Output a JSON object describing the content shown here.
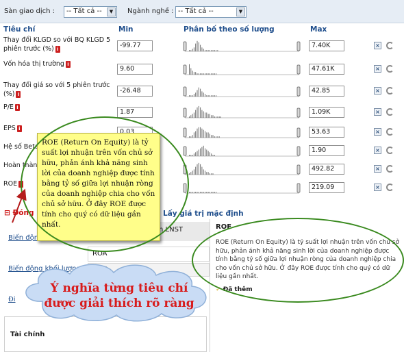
{
  "filters": {
    "exchange_label": "Sàn giao dịch :",
    "exchange_value": "-- Tất cả --",
    "industry_label": "Ngành nghề :",
    "industry_value": "-- Tất cả --"
  },
  "columns": {
    "criteria": "Tiêu chí",
    "min": "Min",
    "distribution": "Phân bố theo số lượng",
    "max": "Max"
  },
  "rows": [
    {
      "label": "Thay đổi KLGD so với BQ KLGD 5 phiên trước (%)",
      "min": "-99.77",
      "max": "7.40K"
    },
    {
      "label": "Vốn hóa thị trường",
      "min": "9.60",
      "max": "47.61K"
    },
    {
      "label": "Thay đổi giá so với 5 phiên trước (%)",
      "min": "-26.48",
      "max": "42.85"
    },
    {
      "label": "P/E",
      "min": "1.87",
      "max": "1.09K"
    },
    {
      "label": "EPS",
      "min": "0.03",
      "max": "53.63"
    },
    {
      "label": "Hệ số Beta",
      "min": "",
      "max": "1.90"
    },
    {
      "label": "Hoàn thành",
      "min": "",
      "max": "492.82"
    },
    {
      "label": "ROE",
      "min": "",
      "max": "219.09"
    }
  ],
  "info_glyph": "i",
  "delete_glyph": "×",
  "bottom": {
    "collapse_label": "Đóng",
    "default_label": "Lấy giá trị mặc định",
    "link1": "Biến động",
    "link2": "Biến động khối lượng",
    "link3": "Đi",
    "net_profit_item": "h LNST",
    "roa_item": "ROA",
    "roe_item": "ROE",
    "finance_tab": "Tài chính"
  },
  "detail_panel": {
    "title": "ROE",
    "description": "ROE (Return On Equity) là tỷ suất lợi nhuận trên vốn chủ sở hữu, phản ánh khả năng sinh lời của doanh nghiệp được tính bằng tỷ số giữa lợi nhuận ròng của doanh nghiệp chia cho vốn chủ sở hữu. Ở đây ROE được tính cho quý có dữ liệu gần nhất.",
    "added_label": "Đã thêm"
  },
  "tooltip": {
    "text": "ROE (Return On Equity) là tỷ suất lợi nhuận trên vốn chủ sở hữu, phản ánh khả năng sinh lời của doanh nghiệp được tính bằng tỷ số giữa lợi nhuận ròng của doanh nghiệp chia cho vốn chủ sở hữu. Ở đây ROE được tính cho quý có dữ liệu gần nhất."
  },
  "callout": {
    "line1": "Ý nghĩa từng tiêu chí",
    "line2": "được giải thích rõ ràng"
  },
  "colors": {
    "header_blue": "#1f4e8c",
    "info_red": "#cc1f1f",
    "tooltip_yellow": "#fffe8a",
    "ellipse_green": "#3a8a1f",
    "callout_red": "#d81c1c",
    "cloud_fill": "#c9dcf5"
  }
}
